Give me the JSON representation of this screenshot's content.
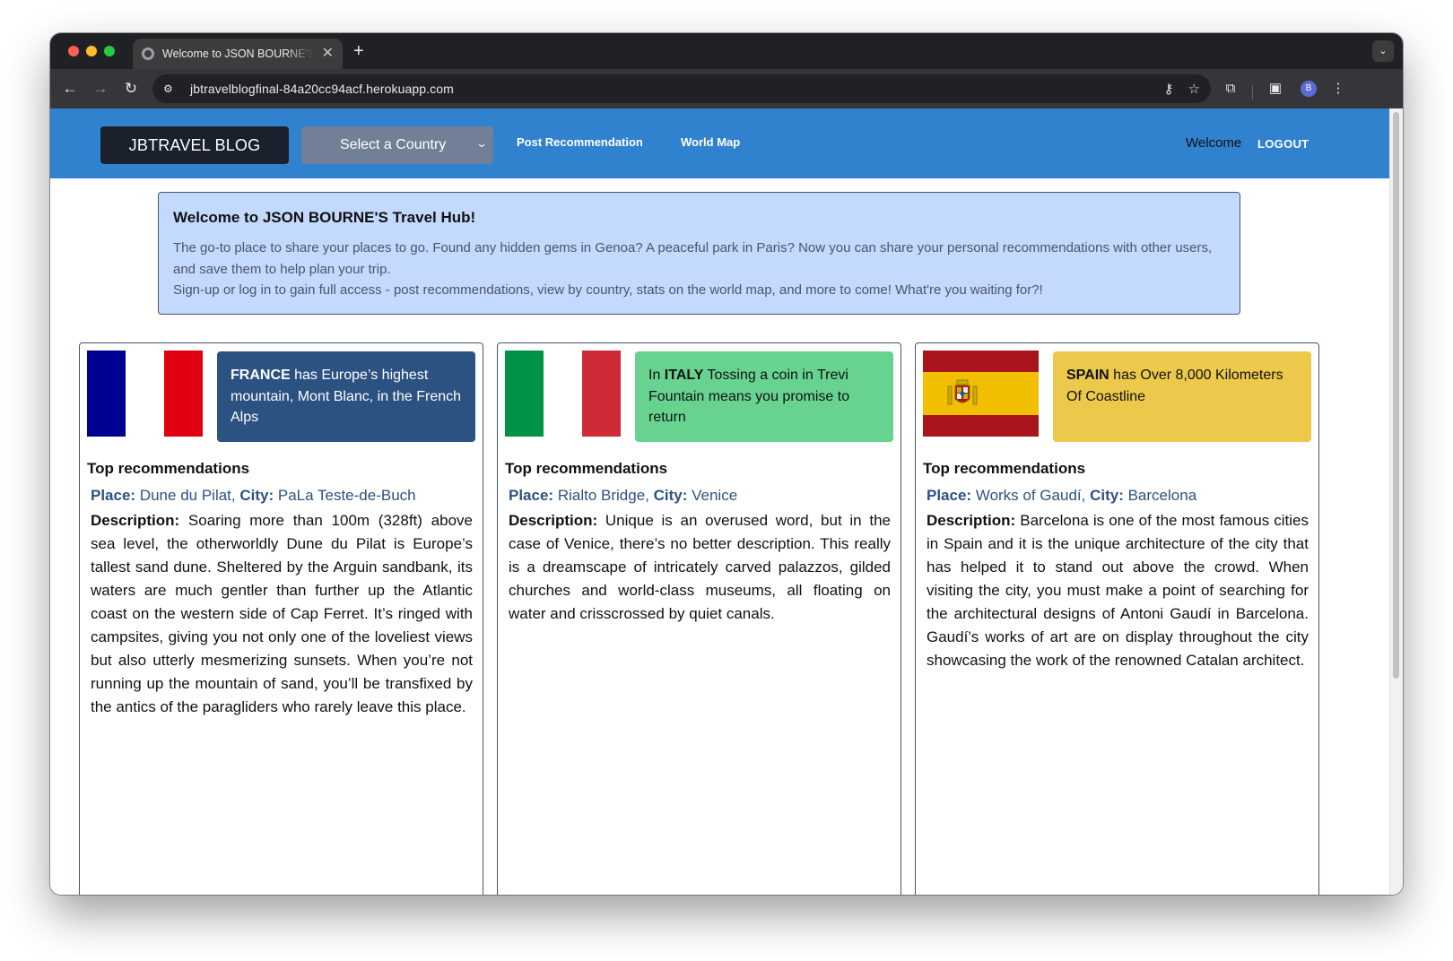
{
  "browser": {
    "tab_title": "Welcome to JSON BOURNE'S",
    "tab_close": "✕",
    "new_tab": "+",
    "tab_search": "⌄",
    "url": "jbtravelblogfinal-84a20cc94acf.herokuapp.com",
    "avatar_initial": "B"
  },
  "navbar": {
    "brand": "JBTRAVEL BLOG",
    "country_select": "Select a Country",
    "post_link": "Post Recommendation",
    "map_link": "World Map",
    "welcome": "Welcome",
    "logout": "LOGOUT"
  },
  "intro": {
    "title": "Welcome to JSON BOURNE'S Travel Hub!",
    "line1": "The go-to place to share your places to go. Found any hidden gems in Genoa? A peaceful park in Paris? Now you can share your personal recommendations with other users, and save them to help plan your trip.",
    "line2": "Sign-up or log in to gain full access - post recommendations, view by country, stats on the world map, and more to come! What're you waiting for?!"
  },
  "labels": {
    "top_reco": "Top recommendations",
    "place": "Place:",
    "city": "City:",
    "description": "Description:"
  },
  "cards": [
    {
      "country": "FRANCE",
      "fact_before": "",
      "fact_after": " has Europe’s highest mountain, Mont Blanc, in the French Alps",
      "flag_colors": [
        "#000091",
        "#ffffff",
        "#e1000f"
      ],
      "place": "Dune du Pilat",
      "city": "PaLa Teste-de-Buch",
      "description": "Soaring more than 100m (328ft) above sea level, the otherworldly Dune du Pilat is Europe’s tallest sand dune. Sheltered by the Arguin sandbank, its waters are much gentler than further up the Atlantic coast on the western side of Cap Ferret. It’s ringed with campsites, giving you not only one of the loveliest views but also utterly mesmerizing sunsets. When you’re not running up the mountain of sand, you’ll be transfixed by the antics of the paragliders who rarely leave this place."
    },
    {
      "country": "ITALY",
      "fact_before": "In ",
      "fact_after": " Tossing a coin in Trevi Fountain means you promise to return",
      "flag_colors": [
        "#009246",
        "#ffffff",
        "#ce2b37"
      ],
      "place": "Rialto Bridge",
      "city": "Venice",
      "description": "Unique is an overused word, but in the case of Venice, there’s no better description. This really is a dreamscape of intricately carved palazzos, gilded churches and world-class museums, all floating on water and crisscrossed by quiet canals."
    },
    {
      "country": "SPAIN",
      "fact_before": "",
      "fact_after": " has Over 8,000 Kilometers Of Coastline",
      "flag_colors": [
        "#aa151b",
        "#f1bf00",
        "#aa151b"
      ],
      "place": "Works of Gaudí",
      "city": "Barcelona",
      "description": "Barcelona is one of the most famous cities in Spain and it is the unique architecture of the city that has helped it to stand out above the crowd. When visiting the city, you must make a point of searching for the architectural designs of Antoni Gaudí in Barcelona. Gaudí’s works of art are on display throughout the city showcasing the work of the renowned Catalan architect."
    }
  ]
}
